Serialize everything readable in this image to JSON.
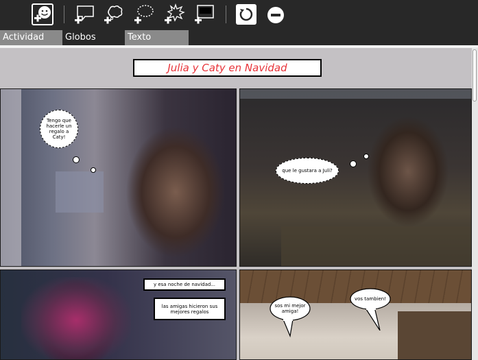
{
  "toolbar": {
    "buttons": [
      {
        "name": "add-picture-button",
        "icon": "smiley-plus-icon",
        "active": true
      },
      {
        "name": "add-speech-globe-button",
        "icon": "speech-bubble-plus-icon"
      },
      {
        "name": "add-thought-globe-button",
        "icon": "thought-bubble-plus-icon"
      },
      {
        "name": "add-whisper-globe-button",
        "icon": "dashed-bubble-plus-icon"
      },
      {
        "name": "add-exclamation-globe-button",
        "icon": "burst-plus-icon"
      },
      {
        "name": "add-box-button",
        "icon": "box-plus-icon"
      },
      {
        "name": "redo-button",
        "icon": "circular-arrow-icon"
      },
      {
        "name": "remove-button",
        "icon": "minus-circle-icon"
      }
    ]
  },
  "tabs": [
    {
      "label": "Actividad"
    },
    {
      "label": "Globos"
    },
    {
      "label": "Texto"
    }
  ],
  "comic": {
    "title": "Julia y Caty en Navidad",
    "title_color": "#e8343a",
    "frame1": {
      "cloud_text": "Tengo que hacerle un regalo a Caty!"
    },
    "frame2": {
      "cloud_text": "que le gustara a Juli?"
    },
    "frame3": {
      "box1_text": "y esa noche de navidad...",
      "box2_text": "las amigas hicieron sus mejores regalos"
    },
    "frame4": {
      "bubble1_text": "sos mi mejor amiga!",
      "bubble2_text": "vos tambien!"
    }
  }
}
